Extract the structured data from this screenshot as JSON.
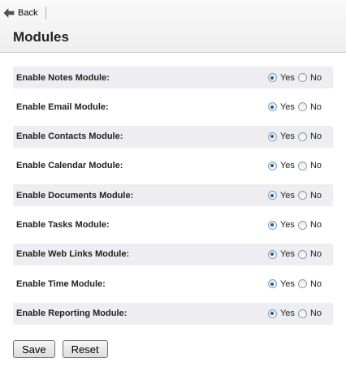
{
  "header": {
    "back_label": "Back",
    "title": "Modules"
  },
  "modules": [
    {
      "label": "Enable Notes Module:",
      "selected": "Yes"
    },
    {
      "label": "Enable Email Module:",
      "selected": "Yes"
    },
    {
      "label": "Enable Contacts Module:",
      "selected": "Yes"
    },
    {
      "label": "Enable Calendar Module:",
      "selected": "Yes"
    },
    {
      "label": "Enable Documents Module:",
      "selected": "Yes"
    },
    {
      "label": "Enable Tasks Module:",
      "selected": "Yes"
    },
    {
      "label": "Enable Web Links Module:",
      "selected": "Yes"
    },
    {
      "label": "Enable Time Module:",
      "selected": "Yes"
    },
    {
      "label": "Enable Reporting Module:",
      "selected": "Yes"
    }
  ],
  "options": {
    "yes": "Yes",
    "no": "No"
  },
  "buttons": {
    "save": "Save",
    "reset": "Reset"
  },
  "icons": {
    "back": "arrow-left-icon"
  },
  "colors": {
    "row_alt": "#eeeef2",
    "accent": "#1d5d9b"
  }
}
